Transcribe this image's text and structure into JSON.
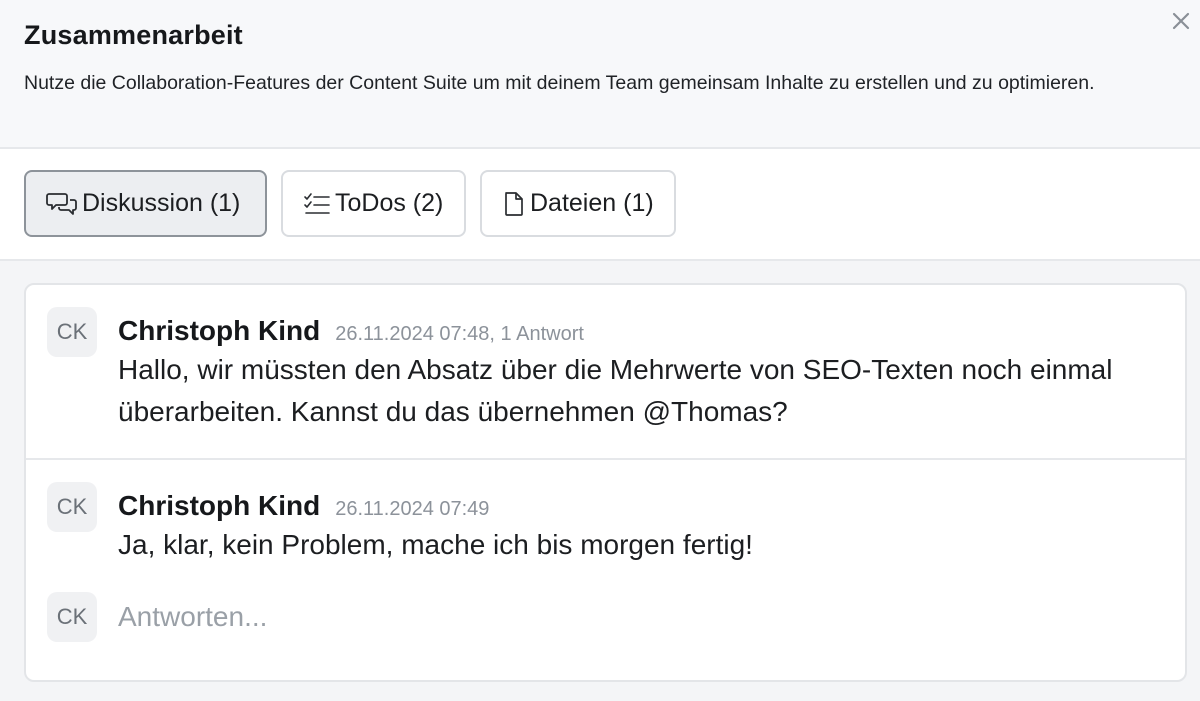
{
  "header": {
    "title": "Zusammenarbeit",
    "description": "Nutze die Collaboration-Features der Content Suite um mit deinem Team gemeinsam Inhalte zu erstellen und zu optimieren.",
    "close_icon": "close-icon"
  },
  "tabs": [
    {
      "label": "Diskussion (1)",
      "icon": "chat-bubbles-icon",
      "active": true
    },
    {
      "label": "ToDos (2)",
      "icon": "checklist-icon",
      "active": false
    },
    {
      "label": "Dateien (1)",
      "icon": "document-icon",
      "active": false
    }
  ],
  "thread": {
    "messages": [
      {
        "initials": "CK",
        "author": "Christoph Kind",
        "meta": "26.11.2024 07:48, 1 Antwort",
        "text": "Hallo, wir müssten den Absatz über die Mehrwerte von SEO-Texten noch einmal überarbeiten. Kannst du das übernehmen @Thomas?"
      },
      {
        "initials": "CK",
        "author": "Christoph Kind",
        "meta": "26.11.2024 07:49",
        "text": "Ja, klar, kein Problem, mache ich bis morgen fertig!"
      }
    ],
    "reply": {
      "initials": "CK",
      "placeholder": "Antworten..."
    }
  }
}
